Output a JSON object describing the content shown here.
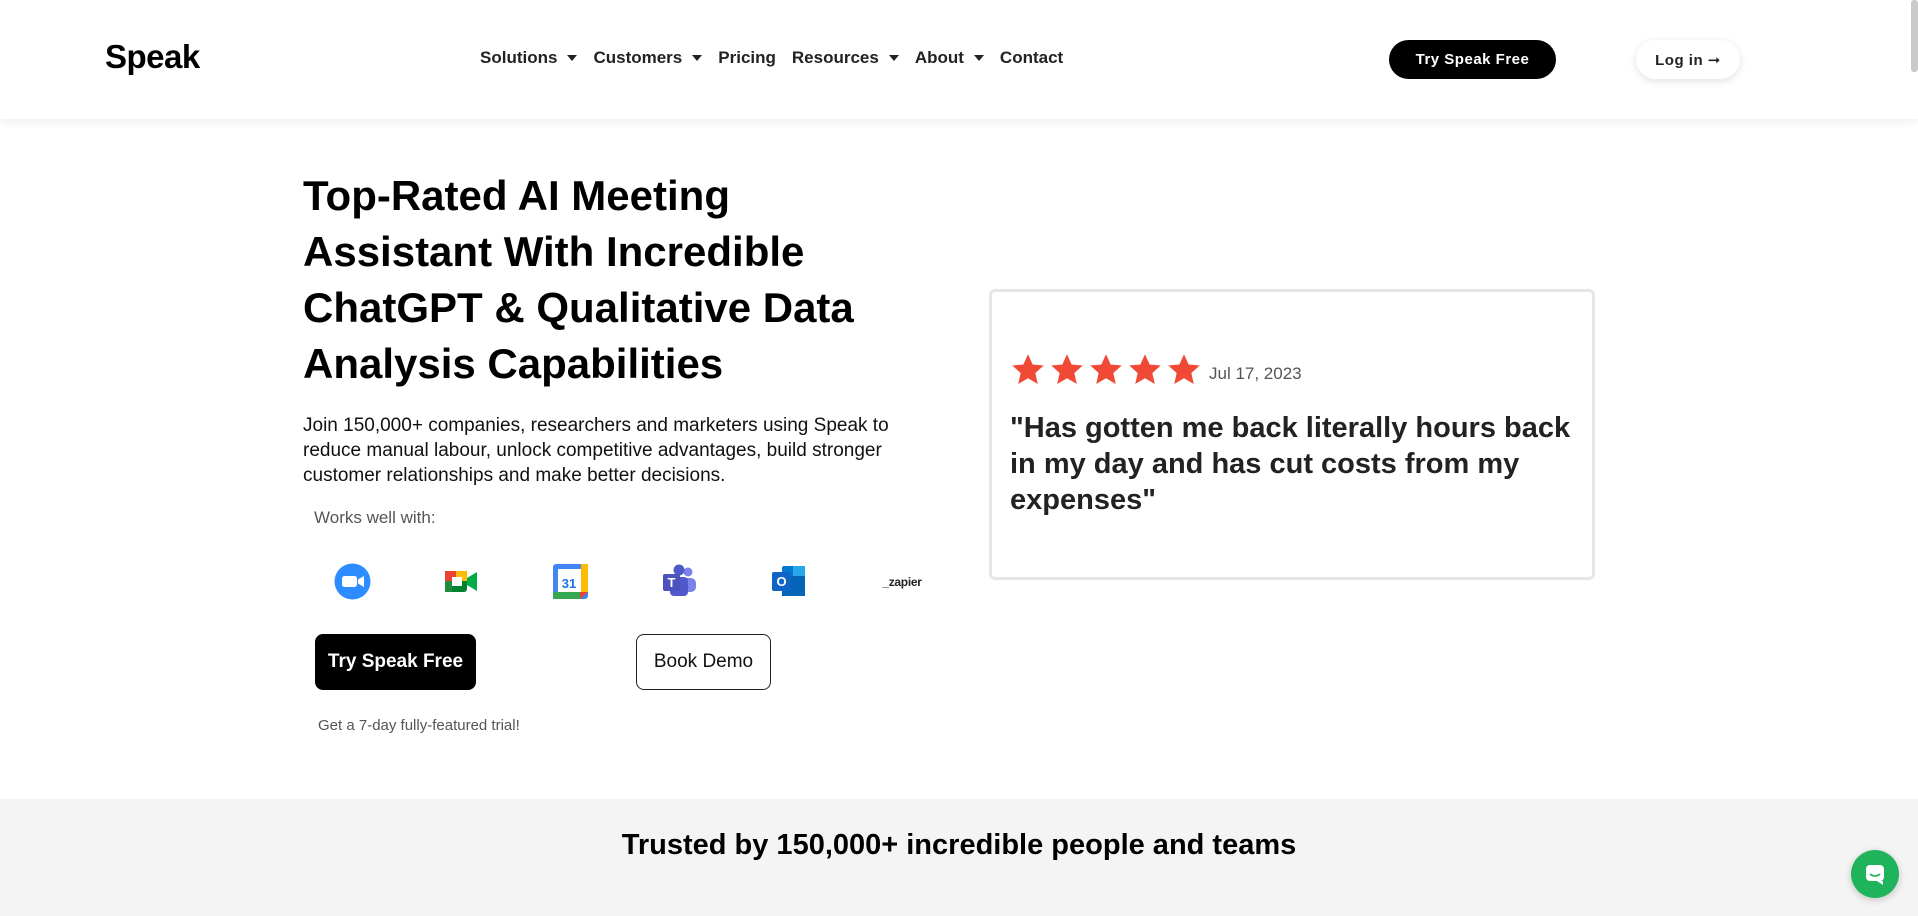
{
  "header": {
    "logo": "Speak",
    "nav": [
      {
        "label": "Solutions",
        "dropdown": true
      },
      {
        "label": "Customers",
        "dropdown": true
      },
      {
        "label": "Pricing",
        "dropdown": false
      },
      {
        "label": "Resources",
        "dropdown": true
      },
      {
        "label": "About",
        "dropdown": true
      },
      {
        "label": "Contact",
        "dropdown": false
      }
    ],
    "try_button": "Try Speak Free",
    "login_button": "Log in ➞"
  },
  "hero": {
    "title": "Top-Rated AI Meeting Assistant With Incredible ChatGPT & Qualitative Data Analysis Capabilities",
    "description": "Join 150,000+ companies, researchers and marketers using Speak to reduce manual labour, unlock competitive advantages, build stronger customer relationships and make better decisions.",
    "works_label": "Works well with:",
    "integrations": [
      "zoom-icon",
      "google-meet-icon",
      "google-calendar-icon",
      "microsoft-teams-icon",
      "outlook-icon",
      "zapier-logo"
    ],
    "calendar_day": "31",
    "zapier_text": "_zapier",
    "try_button": "Try Speak Free",
    "demo_button": "Book Demo",
    "trial_note": "Get a 7-day fully-featured trial!"
  },
  "review": {
    "rating": 5,
    "date": "Jul 17, 2023",
    "quote": "\"Has gotten me back literally hours back in my day and has cut costs from my expenses\"",
    "star_color": "#f04a37"
  },
  "trusted": {
    "title": "Trusted by 150,000+ incredible people and teams"
  },
  "colors": {
    "primary": "#000000",
    "chat": "#1fb35c"
  }
}
